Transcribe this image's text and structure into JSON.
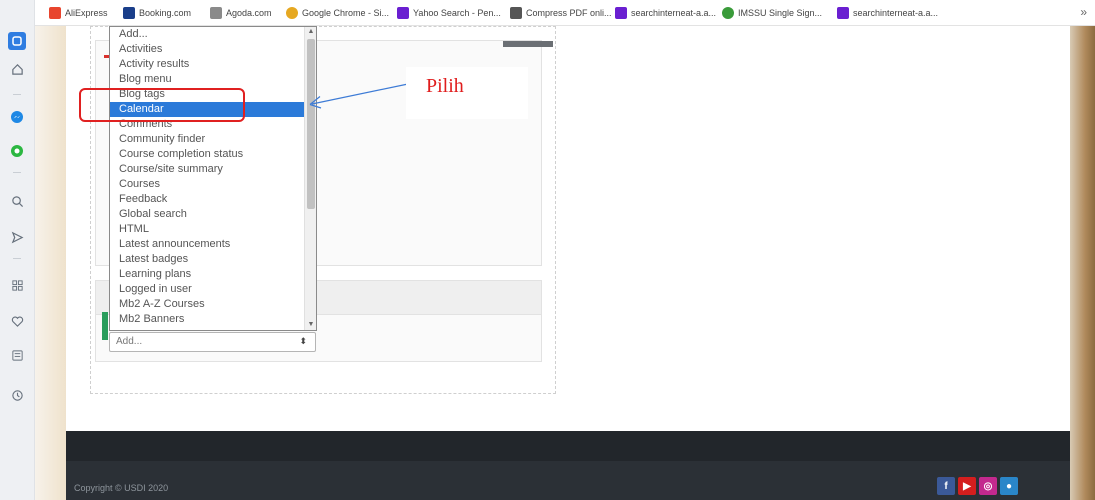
{
  "bookmarks": [
    {
      "label": "AliExpress",
      "color": "#e8452e"
    },
    {
      "label": "Booking.com",
      "color": "#1a3e8a"
    },
    {
      "label": "Agoda.com",
      "color": "#8a8a8a"
    },
    {
      "label": "Google Chrome - Si...",
      "color": "#e6a821"
    },
    {
      "label": "Yahoo Search - Pen...",
      "color": "#6a1fd1"
    },
    {
      "label": "Compress PDF onli...",
      "color": "#555555"
    },
    {
      "label": "searchinterneat-a.a...",
      "color": "#6a1fd1"
    },
    {
      "label": "IMSSU Single Sign...",
      "color": "#3a9b3a"
    },
    {
      "label": "searchinterneat-a.a...",
      "color": "#6a1fd1"
    }
  ],
  "bookmarks_more": "»",
  "sidebar_icons": [
    "browser-home-icon",
    "home-icon",
    "messenger-icon",
    "whatsapp-icon",
    "search-icon",
    "send-icon",
    "apps-icon",
    "heart-icon",
    "news-icon",
    "history-icon"
  ],
  "dropdown": {
    "options": [
      "Add...",
      "Activities",
      "Activity results",
      "Blog menu",
      "Blog tags",
      "Calendar",
      "Comments",
      "Community finder",
      "Course completion status",
      "Course/site summary",
      "Courses",
      "Feedback",
      "Global search",
      "HTML",
      "Latest announcements",
      "Latest badges",
      "Learning plans",
      "Logged in user",
      "Mb2 A-Z Courses",
      "Mb2 Banners"
    ],
    "selected_index": 5,
    "scroll_up": "▲",
    "scroll_down": "▼"
  },
  "add_select": {
    "value": "Add...",
    "arrow": "⬍"
  },
  "annotation": {
    "text": "Pilih",
    "color": "#e01c1c"
  },
  "footer": {
    "copyright": "Copyright © USDI 2020",
    "social": [
      {
        "icon": "facebook-icon",
        "glyph": "f",
        "color": "#3b5998"
      },
      {
        "icon": "youtube-icon",
        "glyph": "▶",
        "color": "#d41e1e"
      },
      {
        "icon": "instagram-icon",
        "glyph": "◎",
        "color": "#c3298e"
      },
      {
        "icon": "globe-icon",
        "glyph": "●",
        "color": "#2a86c9"
      }
    ]
  },
  "colors": {
    "selection": "#2b7ad9",
    "footer_bg": "#2b3036"
  }
}
